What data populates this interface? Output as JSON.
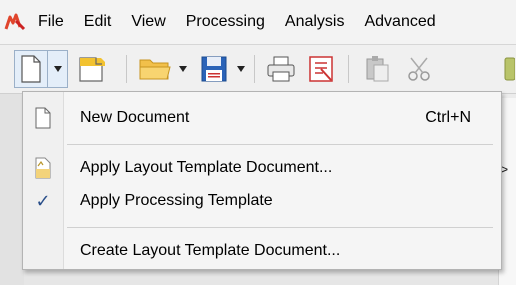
{
  "menubar": {
    "items": [
      "File",
      "Edit",
      "View",
      "Processing",
      "Analysis",
      "Advanced"
    ]
  },
  "toolbar": {
    "icons": [
      "new-document-icon",
      "dropdown-arrow-icon",
      "new-layout-icon",
      "open-folder-icon",
      "save-icon",
      "print-icon",
      "pdf-export-icon",
      "paste-icon",
      "cut-icon"
    ]
  },
  "right_panel": {
    "tab_glyph": ">"
  },
  "dropdown": {
    "items": [
      {
        "label": "New Document",
        "shortcut": "Ctrl+N",
        "icon": "document-icon",
        "checked": false
      },
      {
        "label": "Apply Layout Template Document...",
        "shortcut": "",
        "icon": "layout-template-icon",
        "checked": false
      },
      {
        "label": "Apply Processing Template",
        "shortcut": "",
        "icon": "checkmark-icon",
        "checked": true
      },
      {
        "label": "Create Layout Template Document...",
        "shortcut": "",
        "icon": "",
        "checked": false
      }
    ],
    "check_glyph": "✓"
  }
}
